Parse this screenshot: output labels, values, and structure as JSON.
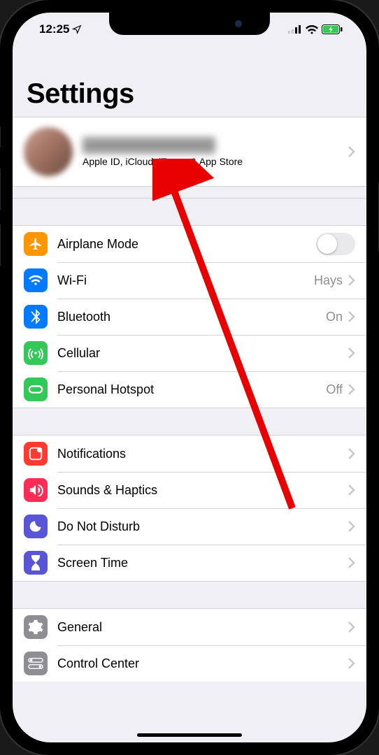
{
  "status": {
    "time": "12:25"
  },
  "title": "Settings",
  "profile": {
    "subtitle": "Apple ID, iCloud, iTunes & App Store"
  },
  "group1": {
    "airplane": "Airplane Mode",
    "wifi": "Wi-Fi",
    "wifi_value": "Hays",
    "bluetooth": "Bluetooth",
    "bluetooth_value": "On",
    "cellular": "Cellular",
    "hotspot": "Personal Hotspot",
    "hotspot_value": "Off"
  },
  "group2": {
    "notifications": "Notifications",
    "sounds": "Sounds & Haptics",
    "dnd": "Do Not Disturb",
    "screentime": "Screen Time"
  },
  "group3": {
    "general": "General",
    "controlcenter": "Control Center"
  }
}
